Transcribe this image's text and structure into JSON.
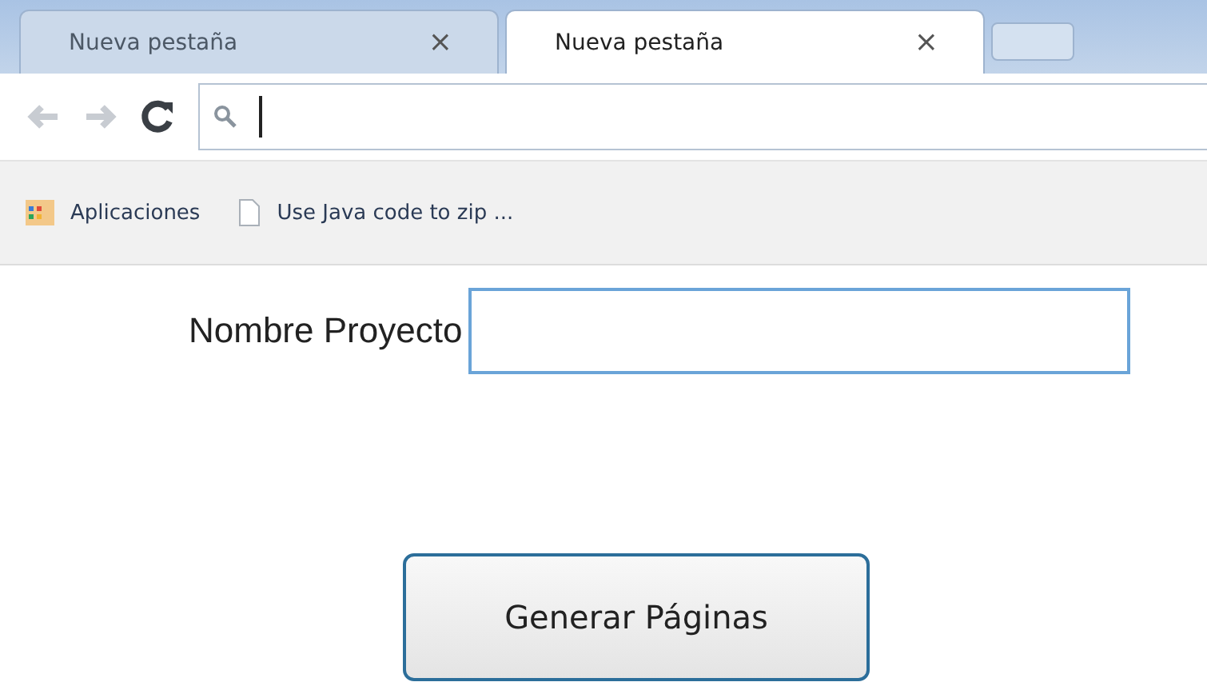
{
  "tabs": [
    {
      "label": "Nueva pestaña",
      "close": "×",
      "selected": false
    },
    {
      "label": "Nueva pestaña",
      "close": "×",
      "selected": true
    }
  ],
  "bookmarks": [
    {
      "kind": "apps",
      "label": "Aplicaciones"
    },
    {
      "kind": "page",
      "label": "Use Java code to zip ..."
    }
  ],
  "form": {
    "label": "Nombre Proyecto"
  },
  "button": "Generar Páginas"
}
